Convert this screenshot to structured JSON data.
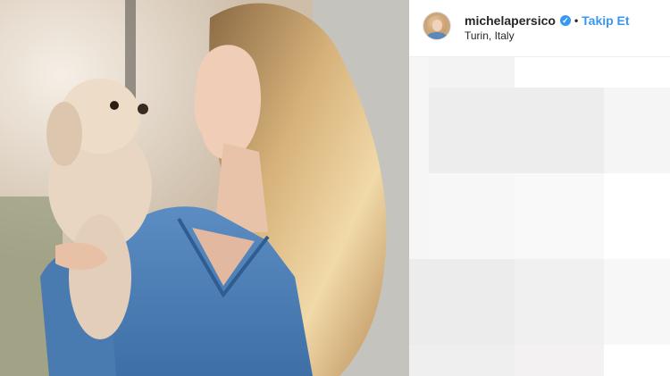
{
  "post": {
    "username": "michelapersico",
    "verified_icon": "✓",
    "separator": "•",
    "follow_label": "Takip Et",
    "location": "Turin, Italy"
  },
  "icons": {
    "verified": "verified-badge-icon"
  },
  "colors": {
    "link_blue": "#3897f0",
    "text": "#262626",
    "border": "#efefef"
  }
}
